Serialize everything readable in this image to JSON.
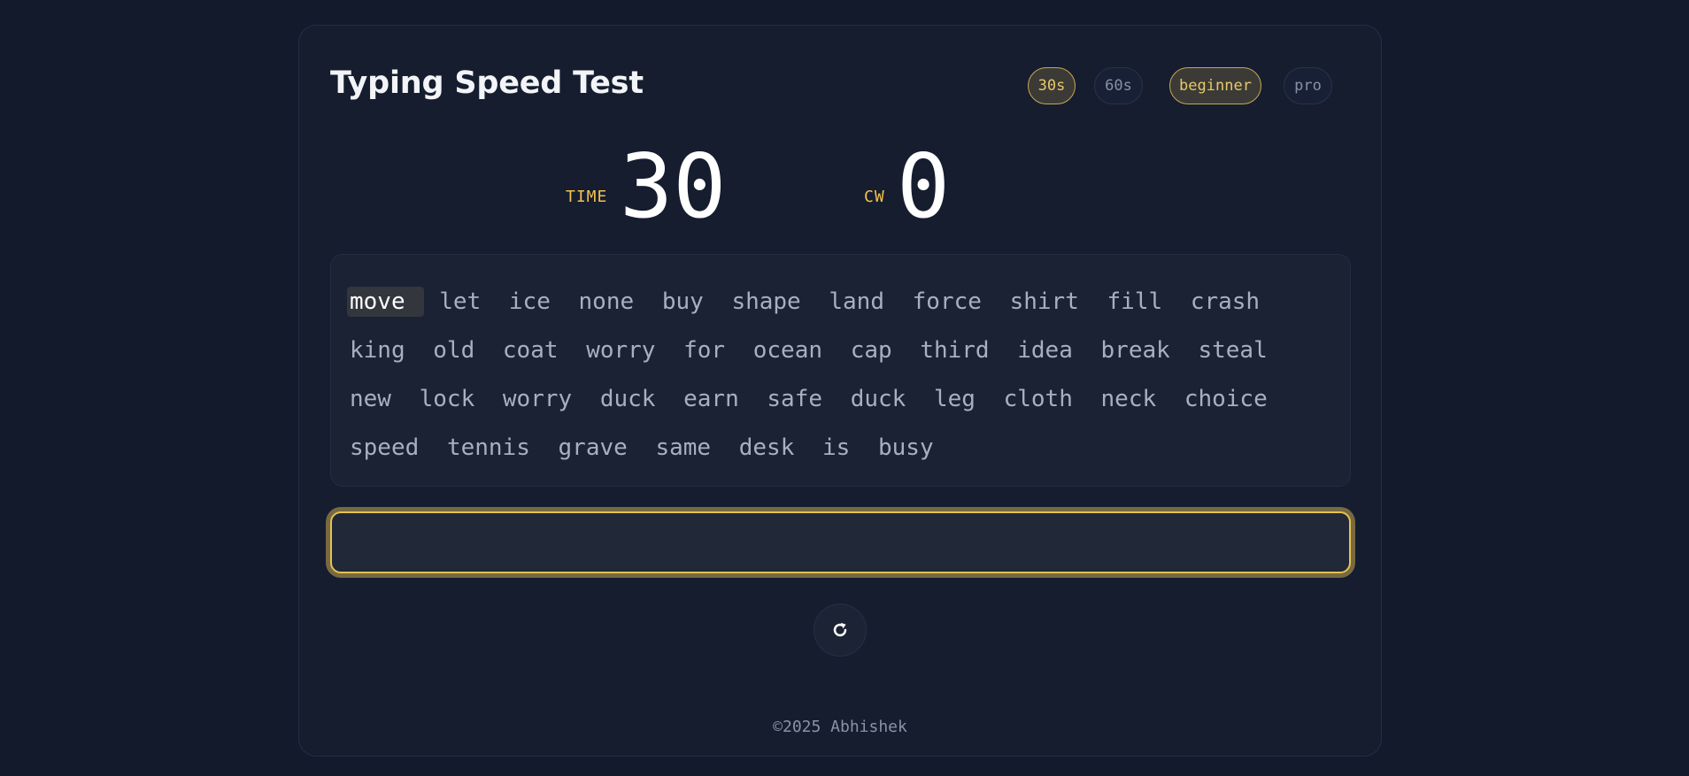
{
  "header": {
    "title": "Typing Speed Test"
  },
  "duration_options": [
    {
      "label": "30s",
      "selected": true
    },
    {
      "label": "60s",
      "selected": false
    }
  ],
  "difficulty_options": [
    {
      "label": "beginner",
      "selected": true
    },
    {
      "label": "pro",
      "selected": false
    }
  ],
  "stats": {
    "time_label": "TIME",
    "time_value": "30",
    "cw_label": "CW",
    "cw_value": "0"
  },
  "words": [
    "move",
    "let",
    "ice",
    "none",
    "buy",
    "shape",
    "land",
    "force",
    "shirt",
    "fill",
    "crash",
    "king",
    "old",
    "coat",
    "worry",
    "for",
    "ocean",
    "cap",
    "third",
    "idea",
    "break",
    "steal",
    "new",
    "lock",
    "worry",
    "duck",
    "earn",
    "safe",
    "duck",
    "leg",
    "cloth",
    "neck",
    "choice",
    "speed",
    "tennis",
    "grave",
    "same",
    "desk",
    "is",
    "busy"
  ],
  "current_word_index": 0,
  "input": {
    "value": "",
    "placeholder": ""
  },
  "restart_icon": "refresh-icon",
  "footer": {
    "text": "©2025 Abhishek"
  },
  "colors": {
    "background": "#121a2b",
    "card": "#151d2f",
    "accent": "#f2c14e",
    "active_pill_border": "#c8a84e",
    "text_primary": "#ffffff",
    "text_muted": "#a8b0c0"
  }
}
